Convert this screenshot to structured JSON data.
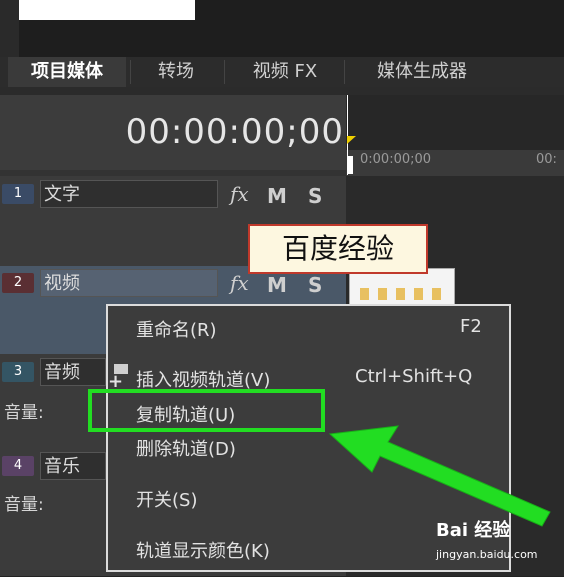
{
  "tabs": [
    {
      "label": "项目媒体",
      "active": true
    },
    {
      "label": "转场",
      "active": false
    },
    {
      "label": "视频 FX",
      "active": false
    },
    {
      "label": "媒体生成器",
      "active": false
    }
  ],
  "timecode": "00:00:00;00",
  "ruler": {
    "start": "0:00:00;00",
    "next": "00:"
  },
  "tracks": [
    {
      "number": "1",
      "name": "文字",
      "fx": "fx",
      "m": "M",
      "s": "S"
    },
    {
      "number": "2",
      "name": "视频",
      "fx": "fx",
      "m": "M",
      "s": "S"
    },
    {
      "number": "3",
      "name": "音频",
      "volume_label": "音量:"
    },
    {
      "number": "4",
      "name": "音乐",
      "volume_label": "音量:"
    }
  ],
  "watermark_label": "百度经验",
  "context_menu": {
    "items": [
      {
        "label": "重命名(R)",
        "shortcut": "F2"
      },
      {
        "label": "插入视频轨道(V)",
        "shortcut": "Ctrl+Shift+Q"
      },
      {
        "label": "复制轨道(U)",
        "shortcut": ""
      },
      {
        "label": "删除轨道(D)",
        "shortcut": ""
      },
      {
        "label": "开关(S)",
        "shortcut": "",
        "has_submenu": true
      },
      {
        "label": "轨道显示颜色(K)",
        "shortcut": ""
      }
    ],
    "highlighted_index": 2
  },
  "branding": {
    "logo": "Bai 经验",
    "url": "jingyan.baidu.com"
  },
  "colors": {
    "highlight": "#22dd22",
    "arrow": "#22dd22",
    "watermark_border": "#c0392b"
  }
}
